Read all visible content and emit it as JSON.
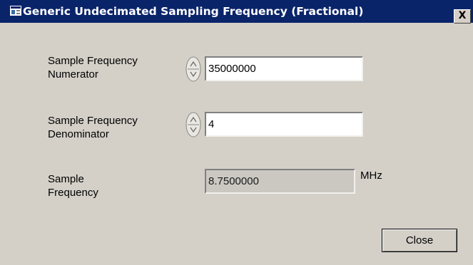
{
  "window": {
    "title": "Generic Undecimated Sampling Frequency (Fractional)",
    "close_glyph": "X",
    "icon": "window-app-icon"
  },
  "fields": {
    "numerator": {
      "label_line1": "Sample Frequency",
      "label_line2": "Numerator",
      "value": "35000000"
    },
    "denominator": {
      "label_line1": "Sample Frequency",
      "label_line2": "Denominator",
      "value": "4"
    },
    "frequency": {
      "label_line1": "Sample",
      "label_line2": "Frequency",
      "value": "8.7500000",
      "unit": "MHz"
    }
  },
  "buttons": {
    "close_label": "Close"
  },
  "colors": {
    "titlebar": "#0a246a",
    "dialog_face": "#d4d0c8",
    "readonly_field": "#cbc8c2"
  }
}
